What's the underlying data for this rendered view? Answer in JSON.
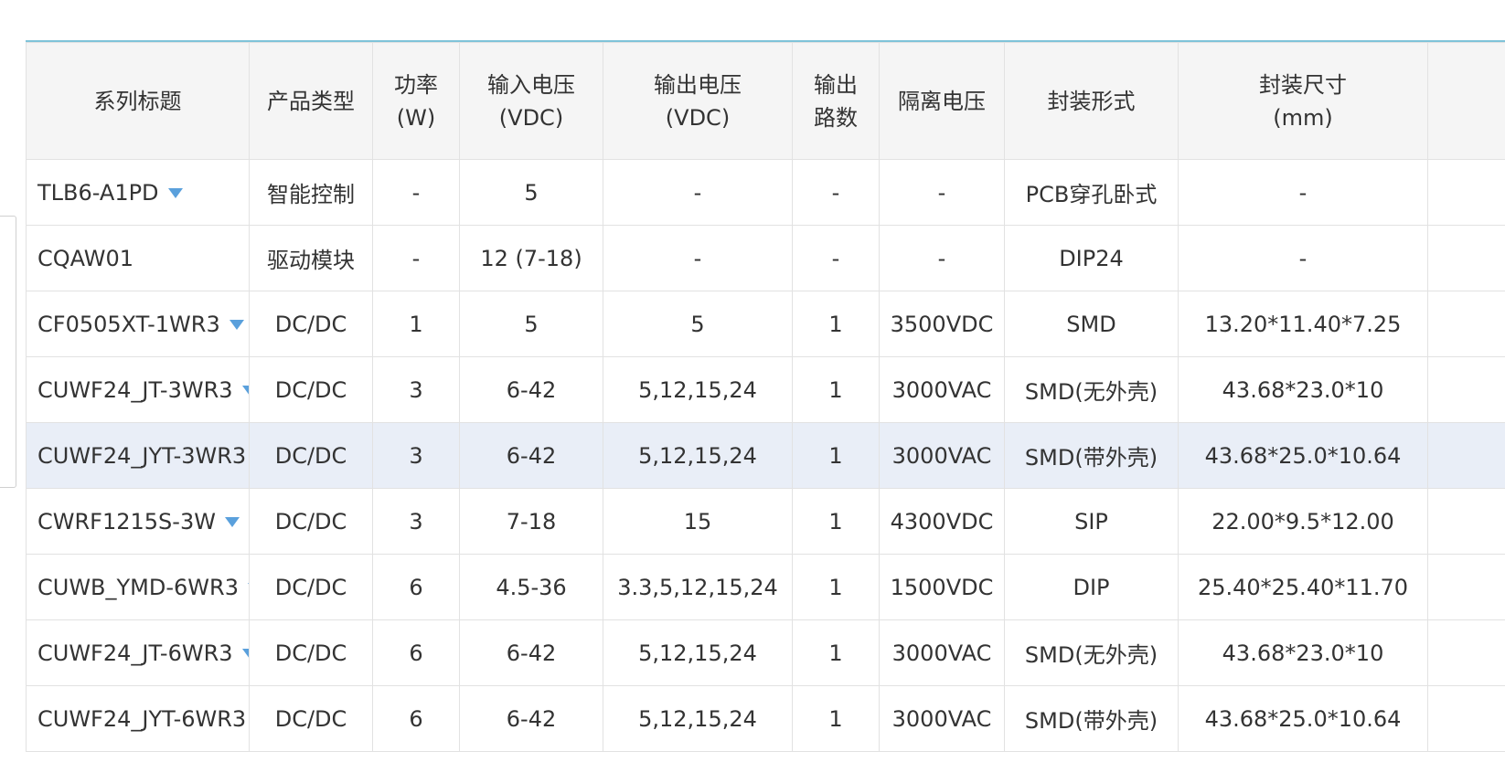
{
  "table": {
    "headers": [
      {
        "line1": "系列标题",
        "line2": ""
      },
      {
        "line1": "产品类型",
        "line2": ""
      },
      {
        "line1": "功率",
        "line2": "(W)"
      },
      {
        "line1": "输入电压",
        "line2": "(VDC)"
      },
      {
        "line1": "输出电压",
        "line2": "(VDC)"
      },
      {
        "line1": "输出",
        "line2": "路数"
      },
      {
        "line1": "隔离电压",
        "line2": ""
      },
      {
        "line1": "封装形式",
        "line2": ""
      },
      {
        "line1": "封装尺寸",
        "line2": "(mm)"
      },
      {
        "line1": "",
        "line2": ""
      }
    ],
    "rows": [
      {
        "series": "TLB6-A1PD",
        "type": "智能控制",
        "power": "-",
        "vin": "5",
        "vout": "-",
        "outputs": "-",
        "isolation": "-",
        "package": "PCB穿孔卧式",
        "size": "-",
        "highlight": false,
        "has_dropdown": true
      },
      {
        "series": "CQAW01",
        "type": "驱动模块",
        "power": "-",
        "vin": "12 (7-18)",
        "vout": "-",
        "outputs": "-",
        "isolation": "-",
        "package": "DIP24",
        "size": "-",
        "highlight": false,
        "has_dropdown": false
      },
      {
        "series": "CF0505XT-1WR3",
        "type": "DC/DC",
        "power": "1",
        "vin": "5",
        "vout": "5",
        "outputs": "1",
        "isolation": "3500VDC",
        "package": "SMD",
        "size": "13.20*11.40*7.25",
        "highlight": false,
        "has_dropdown": true
      },
      {
        "series": "CUWF24_JT-3WR3",
        "type": "DC/DC",
        "power": "3",
        "vin": "6-42",
        "vout": "5,12,15,24",
        "outputs": "1",
        "isolation": "3000VAC",
        "package": "SMD(无外壳)",
        "size": "43.68*23.0*10",
        "highlight": false,
        "has_dropdown": true
      },
      {
        "series": "CUWF24_JYT-3WR3",
        "type": "DC/DC",
        "power": "3",
        "vin": "6-42",
        "vout": "5,12,15,24",
        "outputs": "1",
        "isolation": "3000VAC",
        "package": "SMD(带外壳)",
        "size": "43.68*25.0*10.64",
        "highlight": true,
        "has_dropdown": true
      },
      {
        "series": "CWRF1215S-3W",
        "type": "DC/DC",
        "power": "3",
        "vin": "7-18",
        "vout": "15",
        "outputs": "1",
        "isolation": "4300VDC",
        "package": "SIP",
        "size": "22.00*9.5*12.00",
        "highlight": false,
        "has_dropdown": true
      },
      {
        "series": "CUWB_YMD-6WR3",
        "type": "DC/DC",
        "power": "6",
        "vin": "4.5-36",
        "vout": "3.3,5,12,15,24",
        "outputs": "1",
        "isolation": "1500VDC",
        "package": "DIP",
        "size": "25.40*25.40*11.70",
        "highlight": false,
        "has_dropdown": true
      },
      {
        "series": "CUWF24_JT-6WR3",
        "type": "DC/DC",
        "power": "6",
        "vin": "6-42",
        "vout": "5,12,15,24",
        "outputs": "1",
        "isolation": "3000VAC",
        "package": "SMD(无外壳)",
        "size": "43.68*23.0*10",
        "highlight": false,
        "has_dropdown": true
      },
      {
        "series": "CUWF24_JYT-6WR3",
        "type": "DC/DC",
        "power": "6",
        "vin": "6-42",
        "vout": "5,12,15,24",
        "outputs": "1",
        "isolation": "3000VAC",
        "package": "SMD(带外壳)",
        "size": "43.68*25.0*10.64",
        "highlight": false,
        "has_dropdown": true
      }
    ]
  },
  "colors": {
    "header_bg": "#f5f5f5",
    "highlight_row": "#e9eef7",
    "dropdown_icon": "#5aa0dc",
    "top_border": "#7fc3d9"
  },
  "icons": {
    "dropdown": "triangle-down-icon"
  }
}
